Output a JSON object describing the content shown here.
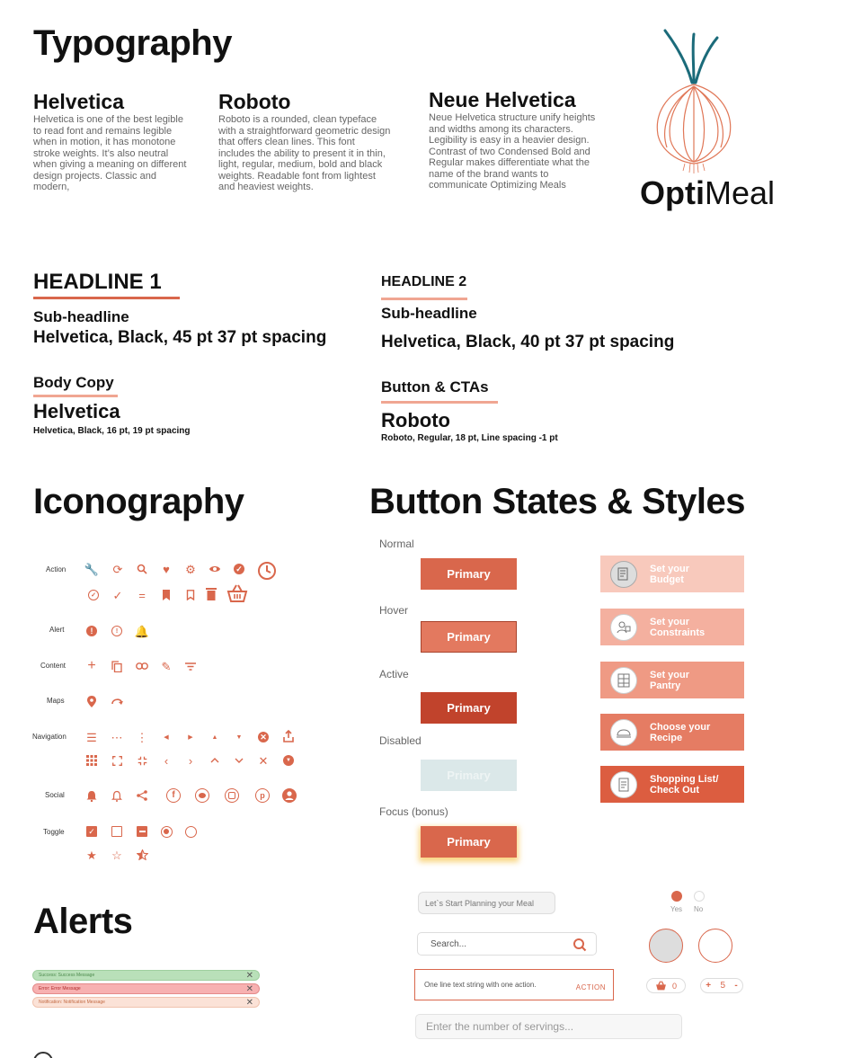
{
  "typography": {
    "title": "Typography",
    "fonts": [
      {
        "name": "Helvetica",
        "desc": "Helvetica is one of the best legible to read font and remains legible when in motion, it has monotone stroke weights. It’s also neutral when giving a meaning on different design projects. Classic and modern,"
      },
      {
        "name": "Roboto",
        "desc": "Roboto is a rounded, clean typeface with a straightforward geometric design that offers clean lines. This font includes the ability to present it in thin, light, regular, medium, bold and black weights. Readable font from lightest and heaviest weights."
      },
      {
        "name": "Neue Helvetica",
        "desc": "Neue Helvetica structure unify heights and widths among its characters. Legibility is easy in a heavier design. Contrast of two Condensed Bold and Regular makes differentiate what the name of the brand wants to communicate Optimizing Meals"
      }
    ]
  },
  "brand": {
    "bold": "Opti",
    "regular": "Meal",
    "accent": "#d9674c",
    "stem_color": "#1b6b7a"
  },
  "type_specs": {
    "h1": {
      "label": "HEADLINE 1",
      "sub": "Sub-headline",
      "spec": "Helvetica, Black, 45 pt 37 pt spacing"
    },
    "h2": {
      "label": "HEADLINE  2",
      "sub": "Sub-headline",
      "spec": "Helvetica, Black, 40 pt 37 pt spacing"
    },
    "body": {
      "label": "Body Copy",
      "font": "Helvetica",
      "spec": "Helvetica, Black, 16 pt, 19 pt spacing"
    },
    "cta": {
      "label": "Button & CTAs",
      "font": "Roboto",
      "spec": "Roboto, Regular, 18 pt, Line spacing -1 pt"
    }
  },
  "iconography": {
    "title": "Iconography",
    "rows": [
      {
        "label": "Action",
        "icons": [
          "wrench-icon",
          "refresh-icon",
          "search-icon",
          "heart-icon",
          "gear-icon",
          "eye-icon",
          "check-circle-icon",
          "clock-icon"
        ]
      },
      {
        "label": "",
        "icons": [
          "check-circle-outline-icon",
          "check-icon",
          "equals-icon",
          "bookmark-icon",
          "bookmark-outline-icon",
          "trash-icon",
          "basket-icon"
        ]
      },
      {
        "label": "Alert",
        "icons": [
          "error-icon",
          "error-outline-icon",
          "bell-alert-icon"
        ]
      },
      {
        "label": "Content",
        "icons": [
          "plus-icon",
          "copy-icon",
          "link-icon",
          "pencil-icon",
          "filter-icon"
        ]
      },
      {
        "label": "Maps",
        "icons": [
          "pin-icon",
          "route-icon"
        ]
      },
      {
        "label": "Navigation",
        "icons": [
          "menu-icon",
          "more-horizontal-icon",
          "more-vertical-icon",
          "caret-left-icon",
          "caret-right-icon",
          "caret-up-icon",
          "caret-down-icon",
          "cancel-icon",
          "share-icon"
        ]
      },
      {
        "label": "",
        "icons": [
          "apps-icon",
          "fullscreen-icon",
          "fullscreen-exit-icon",
          "chevron-left-icon",
          "chevron-right-icon",
          "chevron-up-icon",
          "chevron-down-icon",
          "close-icon",
          "expand-circle-icon"
        ]
      },
      {
        "label": "Social",
        "icons": [
          "bell-icon",
          "bell-outline-icon",
          "share-nodes-icon",
          "facebook-icon",
          "twitter-icon",
          "instagram-icon",
          "pinterest-icon",
          "account-icon"
        ]
      },
      {
        "label": "Toggle",
        "icons": [
          "checkbox-checked-icon",
          "checkbox-empty-icon",
          "checkbox-indeterminate-icon",
          "radio-checked-icon",
          "radio-empty-icon"
        ]
      },
      {
        "label": "",
        "icons": [
          "star-icon",
          "star-outline-icon",
          "star-half-icon"
        ]
      }
    ]
  },
  "buttons": {
    "title": "Button States & Styles",
    "label": "Primary",
    "states": [
      {
        "label": "Normal",
        "bg": "#d9674c"
      },
      {
        "label": "Hover",
        "bg": "#e3795f"
      },
      {
        "label": "Active",
        "bg": "#c1432c"
      },
      {
        "label": "Disabled",
        "bg": "#dbe8e9"
      },
      {
        "label": "Focus (bonus)",
        "bg": "#d9674c"
      }
    ],
    "cards": [
      {
        "line1": "Set your",
        "line2": "Budget",
        "bg": "#f8c9bc",
        "icon": "budget-icon"
      },
      {
        "line1": "Set your",
        "line2": "Constraints",
        "bg": "#f4b09f",
        "icon": "constraints-icon"
      },
      {
        "line1": "Set your",
        "line2": "Pantry",
        "bg": "#ef9a84",
        "icon": "pantry-icon"
      },
      {
        "line1": "Choose your",
        "line2": "Recipe",
        "bg": "#e57c63",
        "icon": "recipe-icon"
      },
      {
        "line1": "Shopping List/",
        "line2": "Check Out",
        "bg": "#dc5d40",
        "icon": "shopping-list-icon"
      }
    ]
  },
  "alerts": {
    "title": "Alerts",
    "items": [
      {
        "text": "Success: Success Message",
        "bg": "#b9e0b9",
        "border": "#9fcf9f",
        "color": "#4d8a4d"
      },
      {
        "text": "Error: Error Message",
        "bg": "#f7b1b1",
        "border": "#e48b8b",
        "color": "#b02a2a"
      },
      {
        "text": "Notification: Notification Message",
        "bg": "#fbe2d7",
        "border": "#f0c3ae",
        "color": "#c26a43"
      }
    ]
  },
  "inputs": {
    "chip": "Let`s Start Planning your Meal",
    "search_placeholder": "Search...",
    "snackbar_text": "One line text string with one action.",
    "snackbar_action": "ACTION",
    "servings_placeholder": "Enter the number of servings...",
    "radio_yes": "Yes",
    "radio_no": "No",
    "basket_count": "0",
    "stepper_plus": "+",
    "stepper_value": "5",
    "stepper_minus": "-"
  }
}
